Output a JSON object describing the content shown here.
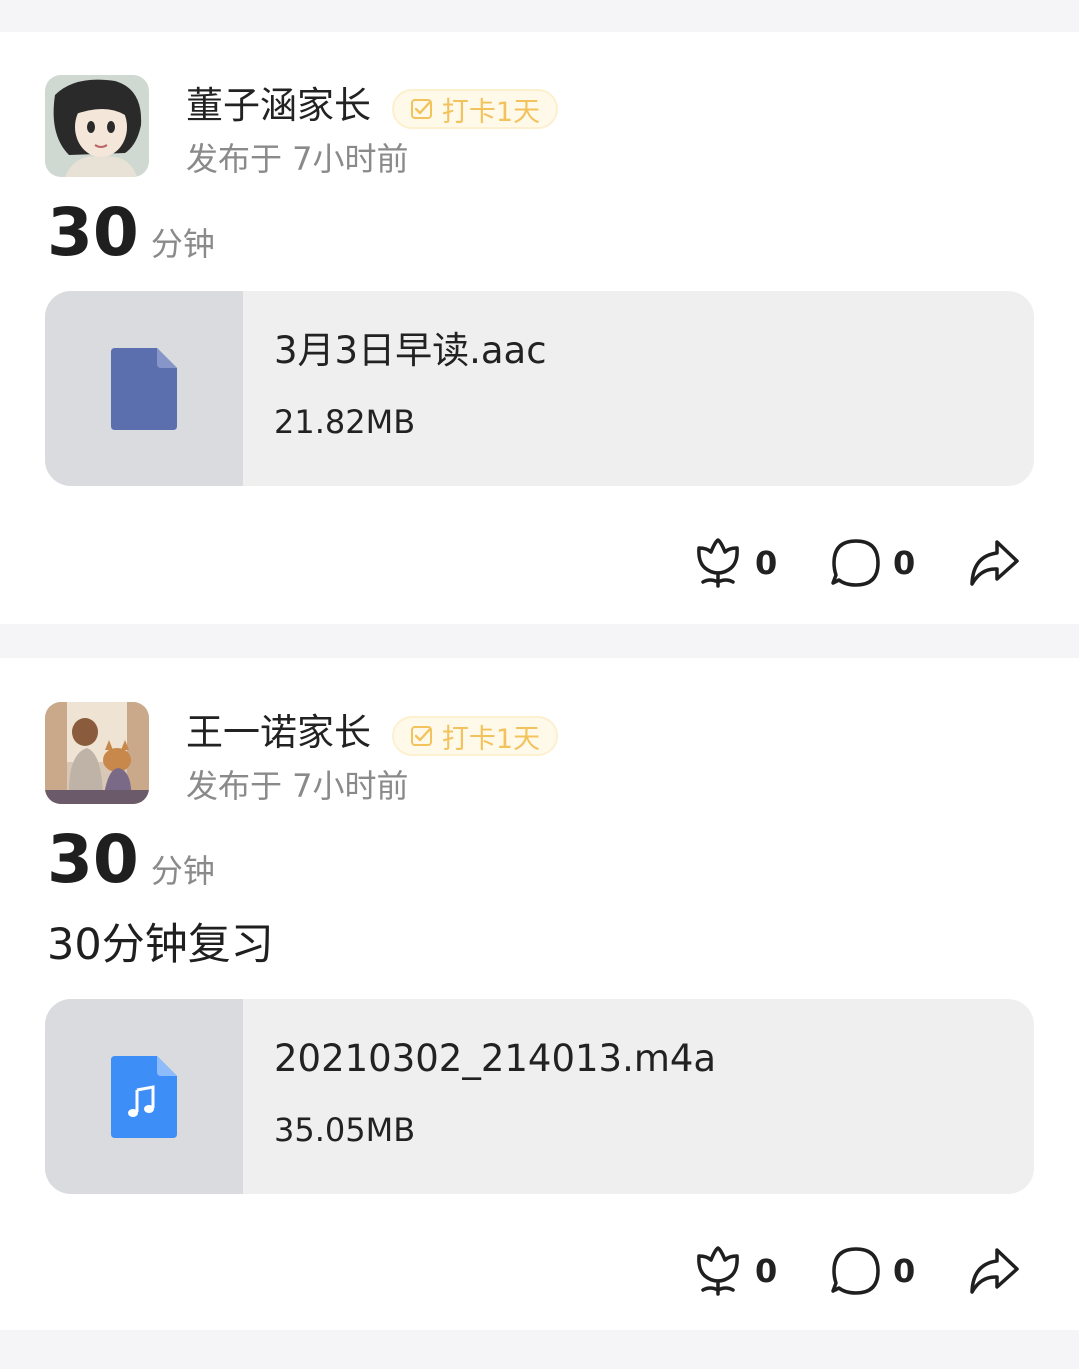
{
  "posts": [
    {
      "author": "董子涵家长",
      "badge": "打卡1天",
      "time": "发布于 7小时前",
      "duration_value": "30",
      "duration_unit": "分钟",
      "text": "",
      "file": {
        "name": "3月3日早读.aac",
        "size": "21.82MB",
        "icon": "file-icon",
        "icon_color": "#5b6fae"
      },
      "likes": "0",
      "comments": "0"
    },
    {
      "author": "王一诺家长",
      "badge": "打卡1天",
      "time": "发布于 7小时前",
      "duration_value": "30",
      "duration_unit": "分钟",
      "text": "30分钟复习",
      "file": {
        "name": "20210302_214013.m4a",
        "size": "35.05MB",
        "icon": "music-file-icon",
        "icon_color": "#3d8ef6"
      },
      "likes": "0",
      "comments": "0"
    }
  ],
  "colors": {
    "badge_text": "#f2c35c",
    "badge_bg": "#fff9ea",
    "muted_text": "#8a8a8a",
    "divider_bg": "#f5f5f7"
  }
}
